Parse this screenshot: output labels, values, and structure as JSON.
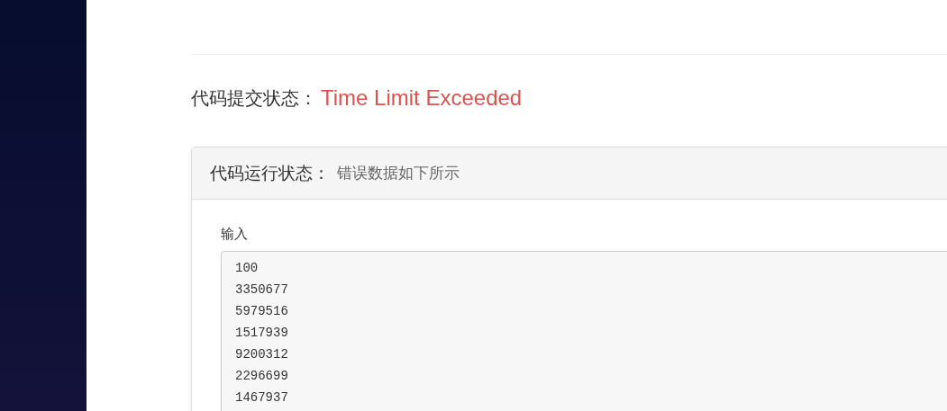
{
  "submission_status": {
    "label": "代码提交状态：",
    "value": "Time Limit Exceeded"
  },
  "run_panel": {
    "label": "代码运行状态：",
    "value": "错误数据如下所示",
    "input": {
      "label": "输入",
      "lines": [
        "100",
        "3350677",
        "5979516",
        "1517939",
        "9200312",
        "2296699",
        "1467937"
      ]
    }
  }
}
